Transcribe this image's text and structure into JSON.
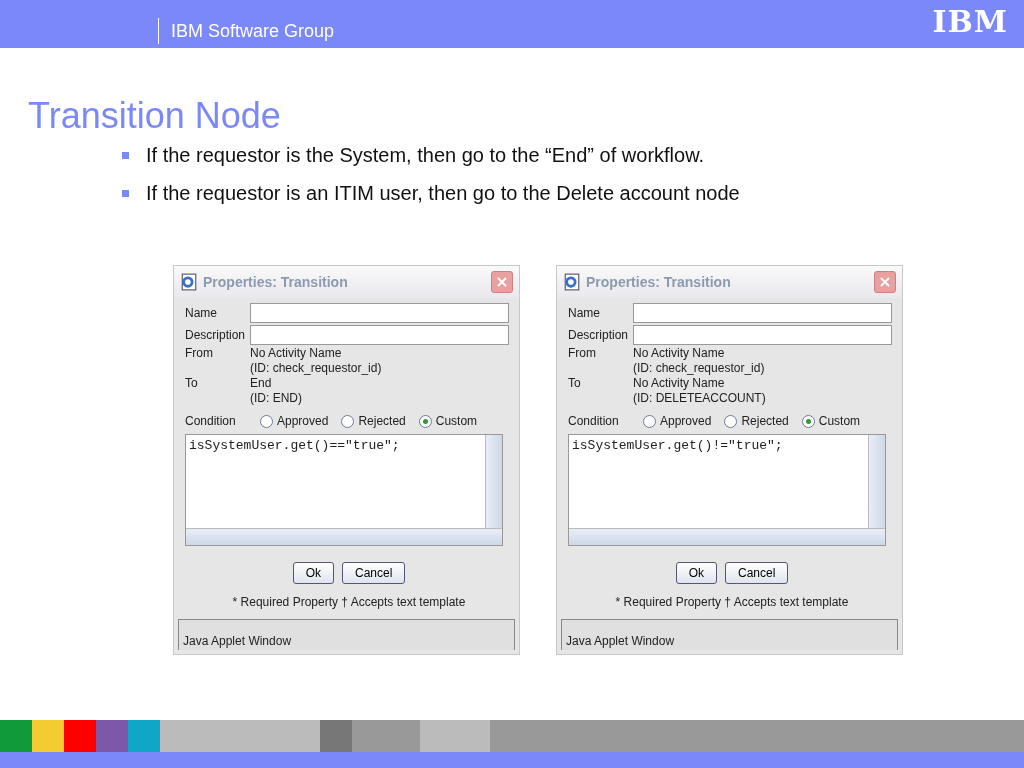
{
  "header": {
    "group": "IBM Software Group",
    "logo": "IBM"
  },
  "title": "Transition Node",
  "bullets": [
    "If the requestor is the System, then go to the “End” of workflow.",
    "If the requestor is an ITIM user, then go to the Delete account node"
  ],
  "dialogs": [
    {
      "title": "Properties: Transition",
      "fields": [
        {
          "label": "Name"
        },
        {
          "label": "Description"
        }
      ],
      "from_label": "From",
      "from": [
        "No Activity Name",
        "(ID: check_requestor_id)"
      ],
      "to_label": "To",
      "to": [
        "End",
        "(ID: END)"
      ],
      "condition_label": "Condition",
      "options": [
        {
          "label": "Approved",
          "selected": false
        },
        {
          "label": "Rejected",
          "selected": false
        },
        {
          "label": "Custom",
          "selected": true
        }
      ],
      "code": "isSystemUser.get()==\"true\";",
      "buttons": [
        "Ok",
        "Cancel"
      ],
      "legend": "* Required Property  † Accepts text template",
      "status": "Java Applet Window"
    },
    {
      "title": "Properties: Transition",
      "fields": [
        {
          "label": "Name"
        },
        {
          "label": "Description"
        }
      ],
      "from_label": "From",
      "from": [
        "No Activity Name",
        "(ID: check_requestor_id)"
      ],
      "to_label": "To",
      "to": [
        "No Activity Name",
        "(ID: DELETEACCOUNT)"
      ],
      "condition_label": "Condition",
      "options": [
        {
          "label": "Approved",
          "selected": false
        },
        {
          "label": "Rejected",
          "selected": false
        },
        {
          "label": "Custom",
          "selected": true
        }
      ],
      "code": "isSystemUser.get()!=\"true\";",
      "buttons": [
        "Ok",
        "Cancel"
      ],
      "legend": "* Required Property  † Accepts text template",
      "status": "Java Applet Window"
    }
  ]
}
